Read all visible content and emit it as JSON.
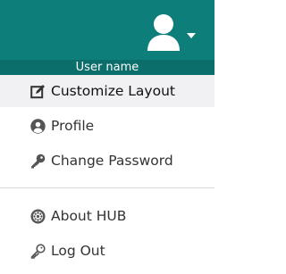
{
  "user": {
    "name": "User name"
  },
  "menu": {
    "items": [
      {
        "label": "Customize Layout",
        "icon": "edit-icon"
      },
      {
        "label": "Profile",
        "icon": "user-circle-icon"
      },
      {
        "label": "Change Password",
        "icon": "key-icon"
      },
      {
        "label": "About HUB",
        "icon": "hub-icon"
      },
      {
        "label": "Log Out",
        "icon": "logout-key-icon"
      }
    ]
  },
  "colors": {
    "header": "#0d7e79",
    "username_bar": "#0c6e6a",
    "active_item": "#f1f1f3",
    "icon": "#555555"
  }
}
